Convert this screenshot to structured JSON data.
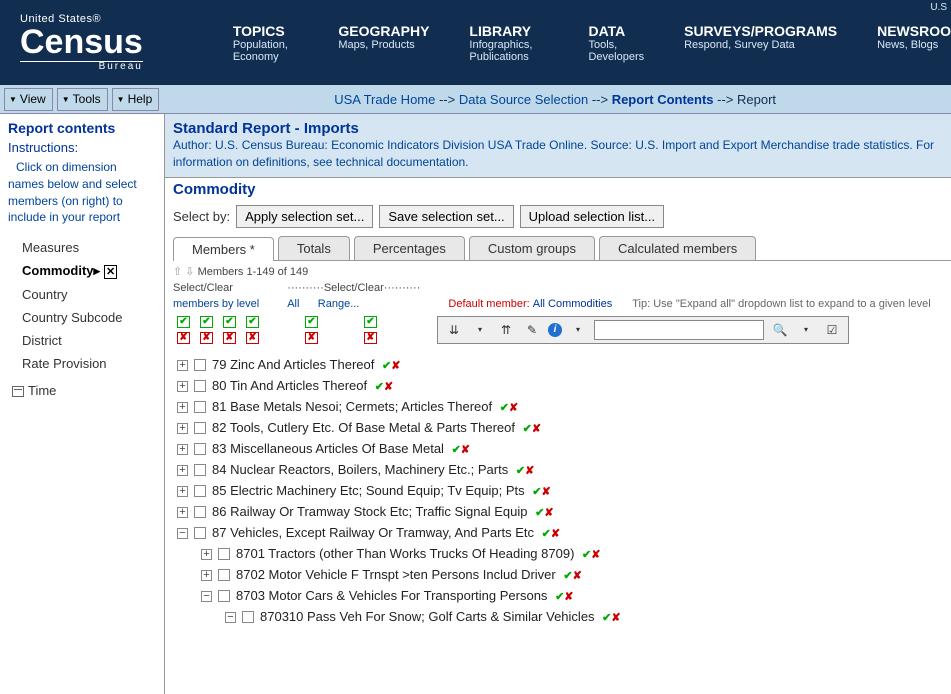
{
  "header": {
    "logo_us": "United States®",
    "logo_main": "Census",
    "logo_sub": "Bureau",
    "ut": "U.S",
    "nav": [
      {
        "title": "TOPICS",
        "sub": "Population, Economy"
      },
      {
        "title": "GEOGRAPHY",
        "sub": "Maps, Products"
      },
      {
        "title": "LIBRARY",
        "sub": "Infographics, Publications"
      },
      {
        "title": "DATA",
        "sub": "Tools, Developers"
      },
      {
        "title": "SURVEYS/PROGRAMS",
        "sub": "Respond, Survey Data"
      },
      {
        "title": "NEWSROO",
        "sub": "News, Blogs"
      }
    ]
  },
  "menus": [
    "View",
    "Tools",
    "Help"
  ],
  "crumb": {
    "a": "USA Trade Home",
    "b": "Data Source Selection",
    "c": "Report Contents",
    "d": "Report",
    "sep": " --> "
  },
  "side": {
    "title": "Report contents",
    "instr_label": "Instructions:",
    "instr": "Click on dimension names below and select members (on right) to include in your report",
    "dims": [
      "Measures",
      "Commodity",
      "Country",
      "Country Subcode",
      "District",
      "Rate Provision"
    ],
    "selected": "Commodity",
    "time": "Time"
  },
  "report": {
    "title": "Standard Report - Imports",
    "author": "Author: U.S. Census Bureau: Economic Indicators Division USA Trade Online. Source: U.S. Import and Export Merchandise trade statistics. For information on definitions, see technical documentation."
  },
  "dimension": "Commodity",
  "selbar": {
    "label": "Select by:",
    "b1": "Apply selection set...",
    "b2": "Save selection set...",
    "b3": "Upload selection list..."
  },
  "tabs": [
    "Members *",
    "Totals",
    "Percentages",
    "Custom groups",
    "Calculated members"
  ],
  "members_count": "Members 1-149 of 149",
  "lev": {
    "sc1": "Select/Clear",
    "sc2": "··········Select/Clear··········",
    "mbl": "members by level",
    "all": "All",
    "range": "Range...",
    "dm_label": "Default member:",
    "dm_value": "All Commodities",
    "tip": "Tip: Use \"Expand all\" dropdown list to expand to a given level"
  },
  "toolbar": {
    "search_ph": ""
  },
  "tree": [
    {
      "lvl": 0,
      "exp": "+",
      "code": "79",
      "txt": "Zinc And Articles Thereof"
    },
    {
      "lvl": 0,
      "exp": "+",
      "code": "80",
      "txt": "Tin And Articles Thereof"
    },
    {
      "lvl": 0,
      "exp": "+",
      "code": "81",
      "txt": "Base Metals Nesoi; Cermets; Articles Thereof"
    },
    {
      "lvl": 0,
      "exp": "+",
      "code": "82",
      "txt": "Tools, Cutlery Etc. Of Base Metal & Parts Thereof"
    },
    {
      "lvl": 0,
      "exp": "+",
      "code": "83",
      "txt": "Miscellaneous Articles Of Base Metal"
    },
    {
      "lvl": 0,
      "exp": "+",
      "code": "84",
      "txt": "Nuclear Reactors, Boilers, Machinery Etc.; Parts"
    },
    {
      "lvl": 0,
      "exp": "+",
      "code": "85",
      "txt": "Electric Machinery Etc; Sound Equip; Tv Equip; Pts"
    },
    {
      "lvl": 0,
      "exp": "+",
      "code": "86",
      "txt": "Railway Or Tramway Stock Etc; Traffic Signal Equip"
    },
    {
      "lvl": 0,
      "exp": "-",
      "code": "87",
      "txt": "Vehicles, Except Railway Or Tramway, And Parts Etc"
    },
    {
      "lvl": 1,
      "exp": "+",
      "code": "8701",
      "txt": "Tractors (other Than Works Trucks Of Heading 8709)"
    },
    {
      "lvl": 1,
      "exp": "+",
      "code": "8702",
      "txt": "Motor Vehicle F Trnspt >ten Persons Includ Driver"
    },
    {
      "lvl": 1,
      "exp": "-",
      "code": "8703",
      "txt": "Motor Cars & Vehicles For Transporting Persons"
    },
    {
      "lvl": 2,
      "exp": "-",
      "code": "870310",
      "txt": "Pass Veh For Snow; Golf Carts & Similar Vehicles"
    }
  ]
}
